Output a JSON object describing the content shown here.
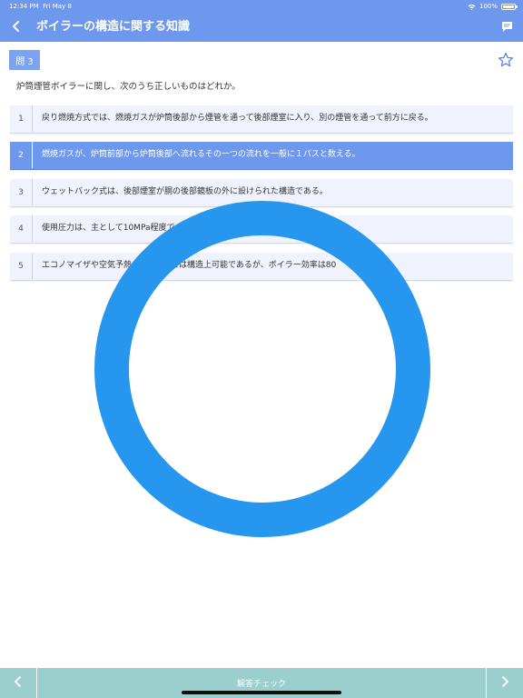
{
  "status_bar": {
    "time": "12:34 PM",
    "date": "Fri May 8",
    "battery": "100%",
    "icons": [
      "wifi-icon",
      "battery-icon"
    ]
  },
  "nav": {
    "title": "ボイラーの構造に関する知識",
    "back_icon": "chevron-left-icon",
    "chat_icon": "chat-bubble-icon"
  },
  "question": {
    "badge": "問 3",
    "text": "炉筒煙管ボイラーに関し、次のうち正しいものはどれか。",
    "favorite_icon": "star-outline-icon"
  },
  "options": [
    {
      "num": "1",
      "text": "戻り燃焼方式では、燃焼ガスが炉筒後部から煙管を通って後部煙室に入り、別の煙管を通って前方に戻る。",
      "selected": false
    },
    {
      "num": "2",
      "text": "燃焼ガスが、炉筒前部から炉筒後部へ流れるその一つの流れを一般に１パスと数える。",
      "selected": true
    },
    {
      "num": "3",
      "text": "ウェットバック式は、後部煙室が胴の後部鏡板の外に設けられた構造である。",
      "selected": false
    },
    {
      "num": "4",
      "text": "使用圧力は、主として10MPa程度で",
      "selected": false
    },
    {
      "num": "5",
      "text": "エコノマイザや空気予熱",
      "text_b": "とは構造上可能であるが、ボイラー効率は80",
      "selected": false
    }
  ],
  "result_overlay": {
    "symbol": "correct-ring",
    "color": "#2796ee"
  },
  "bottom_bar": {
    "check_label": "解答チェック",
    "prev_icon": "chevron-left-icon",
    "next_icon": "chevron-right-icon"
  },
  "colors": {
    "accent": "#6e98ee",
    "option_bg": "#f0f3fd",
    "bottom_bar": "#9acfcd",
    "ring": "#2796ee"
  }
}
